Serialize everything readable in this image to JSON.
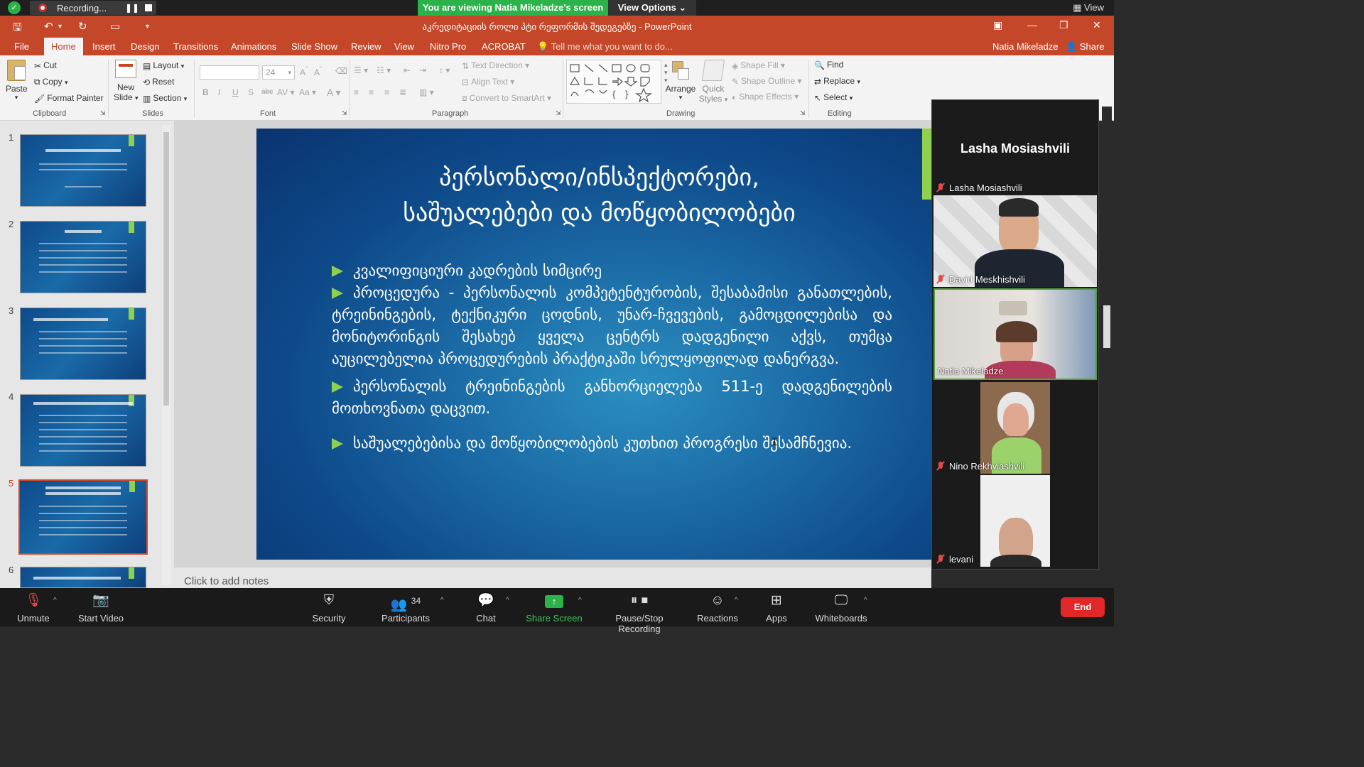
{
  "zoom_top": {
    "recording_label": "Recording...",
    "viewing_banner": "You are viewing Natia Mikeladze's screen",
    "view_options": "View Options",
    "view_label": "View"
  },
  "ppt": {
    "doc_title": "აკრედიტაციის როლი პტი რეფორმის შედეგებზე - PowerPoint",
    "tabs": [
      "File",
      "Home",
      "Insert",
      "Design",
      "Transitions",
      "Animations",
      "Slide Show",
      "Review",
      "View",
      "Nitro Pro",
      "ACROBAT"
    ],
    "tell_me": "Tell me what you want to do...",
    "user": "Natia Mikeladze",
    "share": "Share"
  },
  "ribbon": {
    "clipboard": {
      "paste": "Paste",
      "cut": "Cut",
      "copy": "Copy",
      "format_painter": "Format Painter",
      "group": "Clipboard"
    },
    "slides": {
      "new_slide": "New",
      "new_slide2": "Slide",
      "layout": "Layout",
      "reset": "Reset",
      "section": "Section",
      "group": "Slides"
    },
    "font": {
      "size": "24",
      "group": "Font"
    },
    "paragraph": {
      "text_direction": "Text Direction",
      "align_text": "Align Text",
      "convert": "Convert to SmartArt",
      "group": "Paragraph"
    },
    "drawing": {
      "arrange": "Arrange",
      "quick": "Quick",
      "styles": "Styles",
      "shape_fill": "Shape Fill",
      "shape_outline": "Shape Outline",
      "shape_effects": "Shape Effects",
      "group": "Drawing"
    },
    "editing": {
      "find": "Find",
      "replace": "Replace",
      "select": "Select",
      "group": "Editing"
    }
  },
  "thumbs": {
    "numbers": [
      "1",
      "2",
      "3",
      "4",
      "5",
      "6"
    ],
    "selected": 5
  },
  "slide": {
    "title_line1": "პერსონალი/ინსპექტორები,",
    "title_line2": "საშუალებები და მოწყობილობები",
    "bullets": [
      "კვალიფიციური კადრების სიმცირე",
      "პროცედურა - პერსონალის კომპეტენტურობის, შესაბამისი განათლების, ტრეინინგების, ტექნიკური ცოდნის, უნარ-ჩვევების, გამოცდილებისა და მონიტორინგის შესახებ ყველა ცენტრს დადგენილი აქვს, თუმცა აუცილებელია პროცედურების პრაქტიკაში სრულყოფილად დანერგვა.",
      "პერსონალის ტრეინინგების განხორციელება 511-ე დადგენილების მოთხოვნათა დაცვით.",
      "საშუალებებისა და მოწყობილობების კუთხით პროგრესი შესამჩნევია."
    ]
  },
  "notes_placeholder": "Click to add notes",
  "participants": {
    "active_speaker": "Lasha Mosiashvili",
    "tiles": [
      {
        "name": "Lasha Mosiashvili",
        "muted": true
      },
      {
        "name": "David Meskhishvili",
        "muted": true
      },
      {
        "name": "Natia Mikeladze",
        "muted": false
      },
      {
        "name": "Nino Rekhviashvili",
        "muted": true
      },
      {
        "name": "levani",
        "muted": true
      }
    ]
  },
  "toolbar": {
    "unmute": "Unmute",
    "start_video": "Start Video",
    "security": "Security",
    "participants": "Participants",
    "participant_count": "34",
    "chat": "Chat",
    "share_screen": "Share Screen",
    "pause_stop": "Pause/Stop Recording",
    "reactions": "Reactions",
    "apps": "Apps",
    "whiteboards": "Whiteboards",
    "end": "End"
  },
  "colors": {
    "ppt_accent": "#c5472a",
    "zoom_green": "#2bb34a",
    "slide_accent": "#8fd14f",
    "end_red": "#e02828"
  }
}
